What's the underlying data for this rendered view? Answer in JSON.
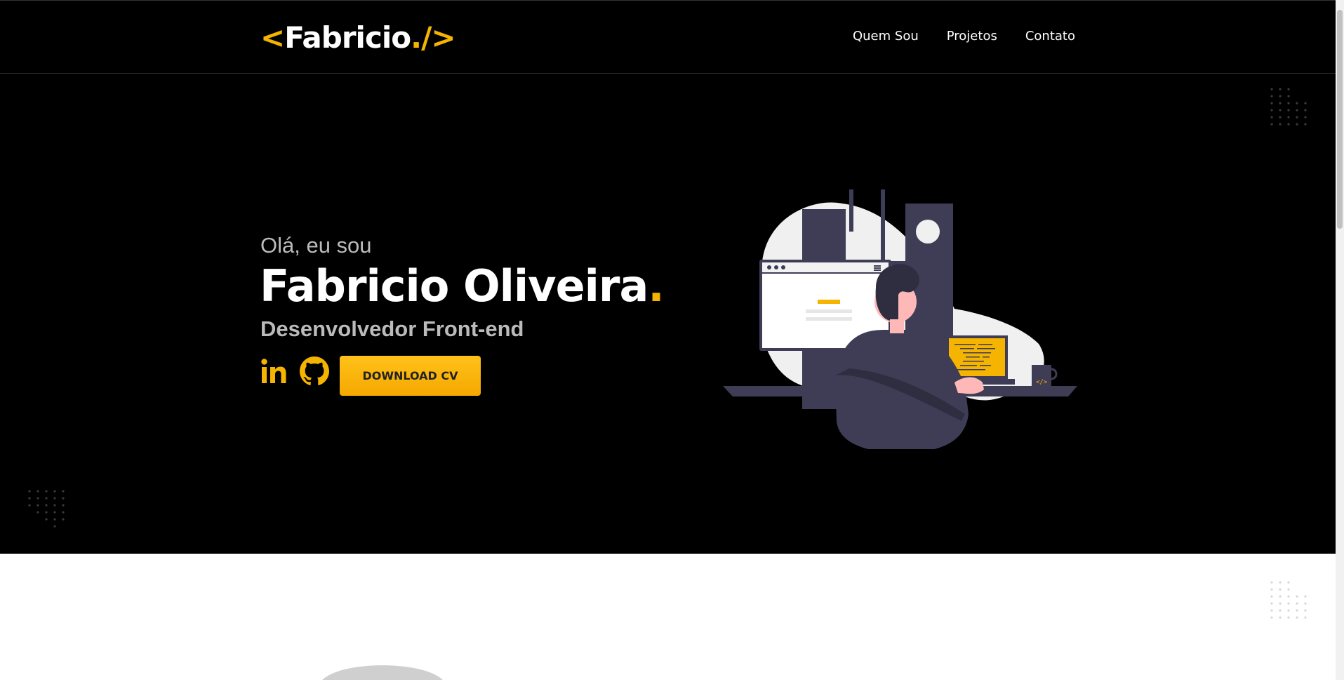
{
  "logo": {
    "open": "<",
    "text": "Fabricio",
    "close": "./>"
  },
  "nav": {
    "items": [
      "Quem Sou",
      "Projetos",
      "Contato"
    ]
  },
  "hero": {
    "greeting": "Olá, eu sou",
    "name": "Fabricio Oliveira",
    "name_dot": ".",
    "role": "Desenvolvedor Front-end",
    "download_label": "DOWNLOAD CV"
  },
  "icons": [
    "linkedin-icon",
    "github-icon"
  ],
  "colors": {
    "accent": "#f5b400",
    "background": "#000000",
    "illustration": "#3f3d56"
  }
}
